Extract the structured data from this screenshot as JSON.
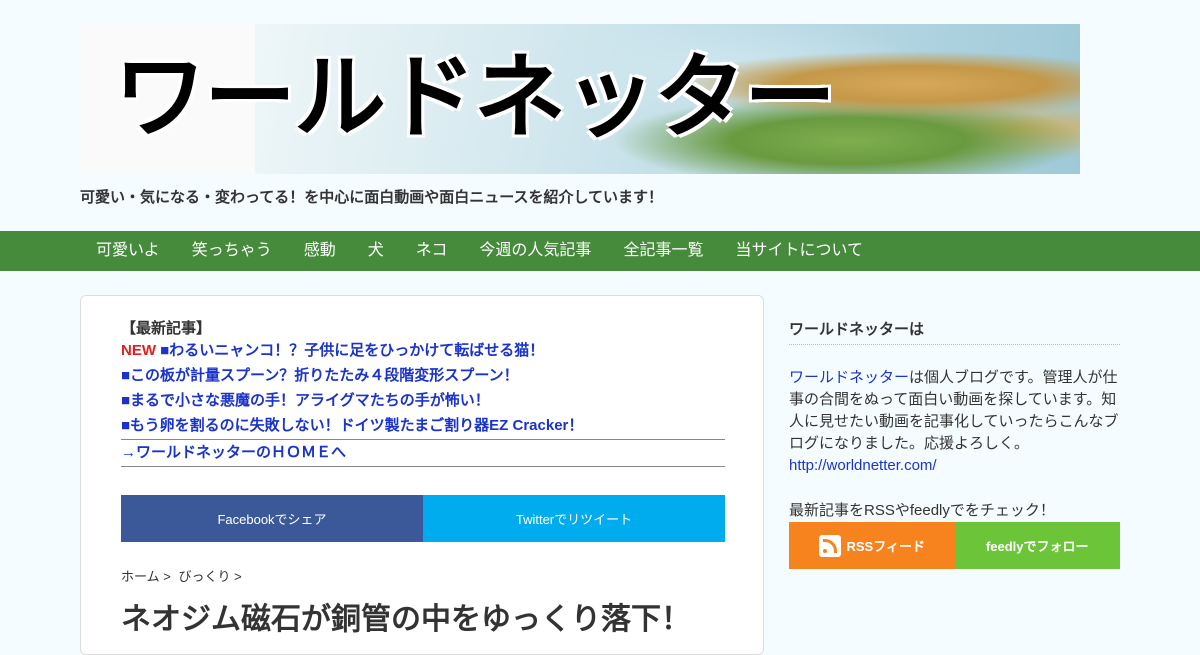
{
  "header": {
    "title": "ワールドネッター",
    "tagline": "可愛い・気になる・変わってる！を中心に面白動画や面白ニュースを紹介しています！"
  },
  "nav": {
    "items": [
      "可愛いよ",
      "笑っちゃう",
      "感動",
      "犬",
      "ネコ",
      "今週の人気記事",
      "全記事一覧",
      "当サイトについて"
    ]
  },
  "latest": {
    "heading": "【最新記事】",
    "new_badge": "NEW",
    "articles": [
      "■わるいニャンコ！？子供に足をひっかけて転ばせる猫！",
      "■この板が計量スプーン？折りたたみ４段階変形スプーン！",
      "■まるで小さな悪魔の手！アライグマたちの手が怖い！",
      "■もう卵を割るのに失敗しない！ドイツ製たまご割り器EZ Cracker！"
    ],
    "home_link": "→ワールドネッターのＨＯＭＥへ"
  },
  "share": {
    "facebook": "Facebookでシェア",
    "twitter": "Twitterでリツイート"
  },
  "breadcrumb": [
    "ホーム",
    ">",
    "びっくり",
    ">"
  ],
  "post": {
    "title": "ネオジム磁石が銅管の中をゆっくり落下！"
  },
  "sidebar": {
    "heading": "ワールドネッターは",
    "intro_link": "ワールドネッター",
    "intro_text": "は個人ブログです。管理人が仕事の合間をぬって面白い動画を探しています。知人に見せたい動画を記事化していったらこんなブログになりました。応援よろしく。",
    "url": "http://worldnetter.com/",
    "check_text": "最新記事をRSSやfeedlyでをチェック！",
    "rss_label": "RSSフィード",
    "feedly_label": "feedlyでフォロー"
  },
  "colors": {
    "nav_bg": "#468a3c",
    "link": "#1a33cc",
    "new_badge": "#e02020",
    "facebook": "#3b5998",
    "twitter": "#00acee",
    "rss": "#f7831f",
    "feedly": "#6cc539"
  }
}
